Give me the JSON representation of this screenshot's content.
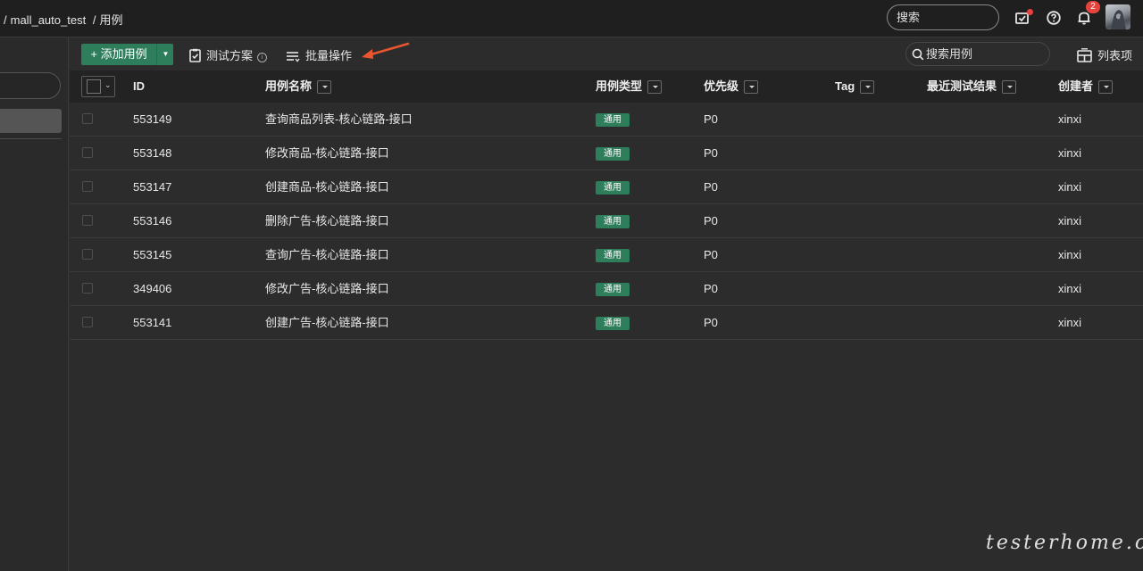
{
  "breadcrumb": {
    "sep1": "/",
    "project": "mall_auto_test",
    "sep2": "/",
    "page": "用例"
  },
  "header": {
    "search_placeholder": "搜索",
    "notification_count": "2"
  },
  "toolbar": {
    "add_label": "添加用例",
    "plan_label": "测试方案",
    "batch_label": "批量操作",
    "search_placeholder": "搜索用例",
    "columns_label": "列表项"
  },
  "table": {
    "headers": {
      "id": "ID",
      "name": "用例名称",
      "type": "用例类型",
      "priority": "优先级",
      "tag": "Tag",
      "last_result": "最近测试结果",
      "creator": "创建者"
    },
    "rows": [
      {
        "id": "553149",
        "name": "查询商品列表-核心链路-接口",
        "type": "通用",
        "priority": "P0",
        "tag": "",
        "last_result": "",
        "creator": "xinxi"
      },
      {
        "id": "553148",
        "name": "修改商品-核心链路-接口",
        "type": "通用",
        "priority": "P0",
        "tag": "",
        "last_result": "",
        "creator": "xinxi"
      },
      {
        "id": "553147",
        "name": "创建商品-核心链路-接口",
        "type": "通用",
        "priority": "P0",
        "tag": "",
        "last_result": "",
        "creator": "xinxi"
      },
      {
        "id": "553146",
        "name": "删除广告-核心链路-接口",
        "type": "通用",
        "priority": "P0",
        "tag": "",
        "last_result": "",
        "creator": "xinxi"
      },
      {
        "id": "553145",
        "name": "查询广告-核心链路-接口",
        "type": "通用",
        "priority": "P0",
        "tag": "",
        "last_result": "",
        "creator": "xinxi"
      },
      {
        "id": "349406",
        "name": "修改广告-核心链路-接口",
        "type": "通用",
        "priority": "P0",
        "tag": "",
        "last_result": "",
        "creator": "xinxi"
      },
      {
        "id": "553141",
        "name": "创建广告-核心链路-接口",
        "type": "通用",
        "priority": "P0",
        "tag": "",
        "last_result": "",
        "creator": "xinxi"
      }
    ]
  },
  "watermark": "testerhome.com",
  "colors": {
    "accent": "#2e7d5b",
    "badge": "#e5433d",
    "arrow": "#e8552f"
  }
}
